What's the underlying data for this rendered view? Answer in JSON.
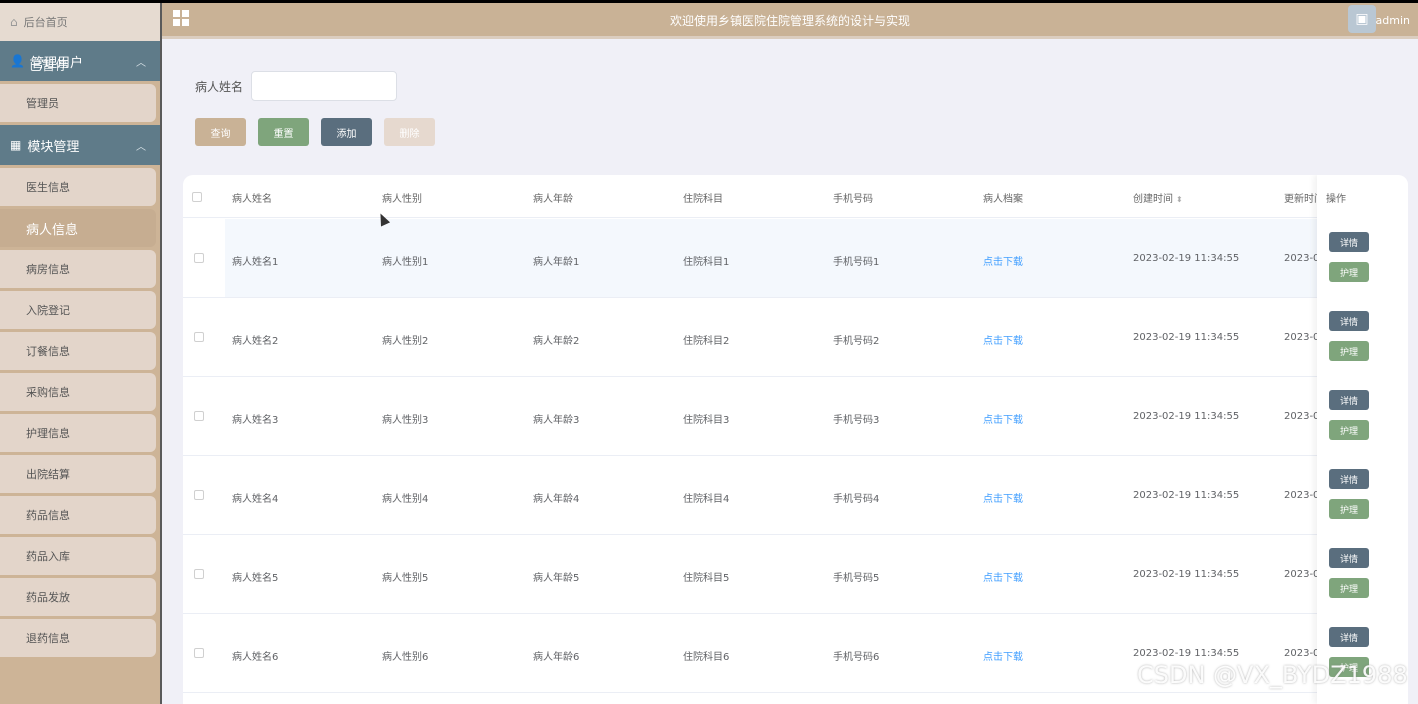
{
  "header": {
    "title": "欢迎使用乡镇医院住院管理系统的设计与实现",
    "user": "admin",
    "menu_icon": "grid-icon",
    "avatar_icon": "image-icon"
  },
  "sidebar": {
    "home": "后台首页",
    "group1": {
      "label": "管理用户",
      "label_overlap": "已暂停"
    },
    "group1_items": [
      "管理员"
    ],
    "group2": {
      "label": "模块管理"
    },
    "group2_items": [
      "医生信息",
      "病人信息",
      "病房信息",
      "入院登记",
      "订餐信息",
      "采购信息",
      "护理信息",
      "出院结算",
      "药品信息",
      "药品入库",
      "药品发放",
      "退药信息"
    ],
    "active_item": "病人信息"
  },
  "search": {
    "label": "病人姓名",
    "value": "",
    "placeholder": ""
  },
  "buttons": {
    "query": "查询",
    "reset": "重置",
    "add": "添加",
    "delete": "删除"
  },
  "table": {
    "headers": [
      "病人姓名",
      "病人性别",
      "病人年龄",
      "住院科目",
      "手机号码",
      "病人档案",
      "创建时间",
      "更新时间",
      "操作"
    ],
    "rows": [
      {
        "name": "病人姓名1",
        "gender": "病人性别1",
        "age": "病人年龄1",
        "dept": "住院科目1",
        "phone": "手机号码1",
        "file": "点击下载",
        "created": "2023-02-19 11:34:55",
        "updated": "2023-0"
      },
      {
        "name": "病人姓名2",
        "gender": "病人性别2",
        "age": "病人年龄2",
        "dept": "住院科目2",
        "phone": "手机号码2",
        "file": "点击下载",
        "created": "2023-02-19 11:34:55",
        "updated": "2023-0"
      },
      {
        "name": "病人姓名3",
        "gender": "病人性别3",
        "age": "病人年龄3",
        "dept": "住院科目3",
        "phone": "手机号码3",
        "file": "点击下载",
        "created": "2023-02-19 11:34:55",
        "updated": "2023-0"
      },
      {
        "name": "病人姓名4",
        "gender": "病人性别4",
        "age": "病人年龄4",
        "dept": "住院科目4",
        "phone": "手机号码4",
        "file": "点击下载",
        "created": "2023-02-19 11:34:55",
        "updated": "2023-0"
      },
      {
        "name": "病人姓名5",
        "gender": "病人性别5",
        "age": "病人年龄5",
        "dept": "住院科目5",
        "phone": "手机号码5",
        "file": "点击下载",
        "created": "2023-02-19 11:34:55",
        "updated": "2023-0"
      },
      {
        "name": "病人姓名6",
        "gender": "病人性别6",
        "age": "病人年龄6",
        "dept": "住院科目6",
        "phone": "手机号码6",
        "file": "点击下载",
        "created": "2023-02-19 11:34:55",
        "updated": "2023-0"
      }
    ],
    "op_detail": "详情",
    "op_nurse": "护理"
  },
  "watermark": "CSDN @VX_BYDZ1988",
  "colors": {
    "brand": "#c9b296",
    "nav_group": "#5f7b89",
    "detail_button": "#5a6e7e",
    "nurse_button": "#7fa57c",
    "link": "#409eff"
  }
}
